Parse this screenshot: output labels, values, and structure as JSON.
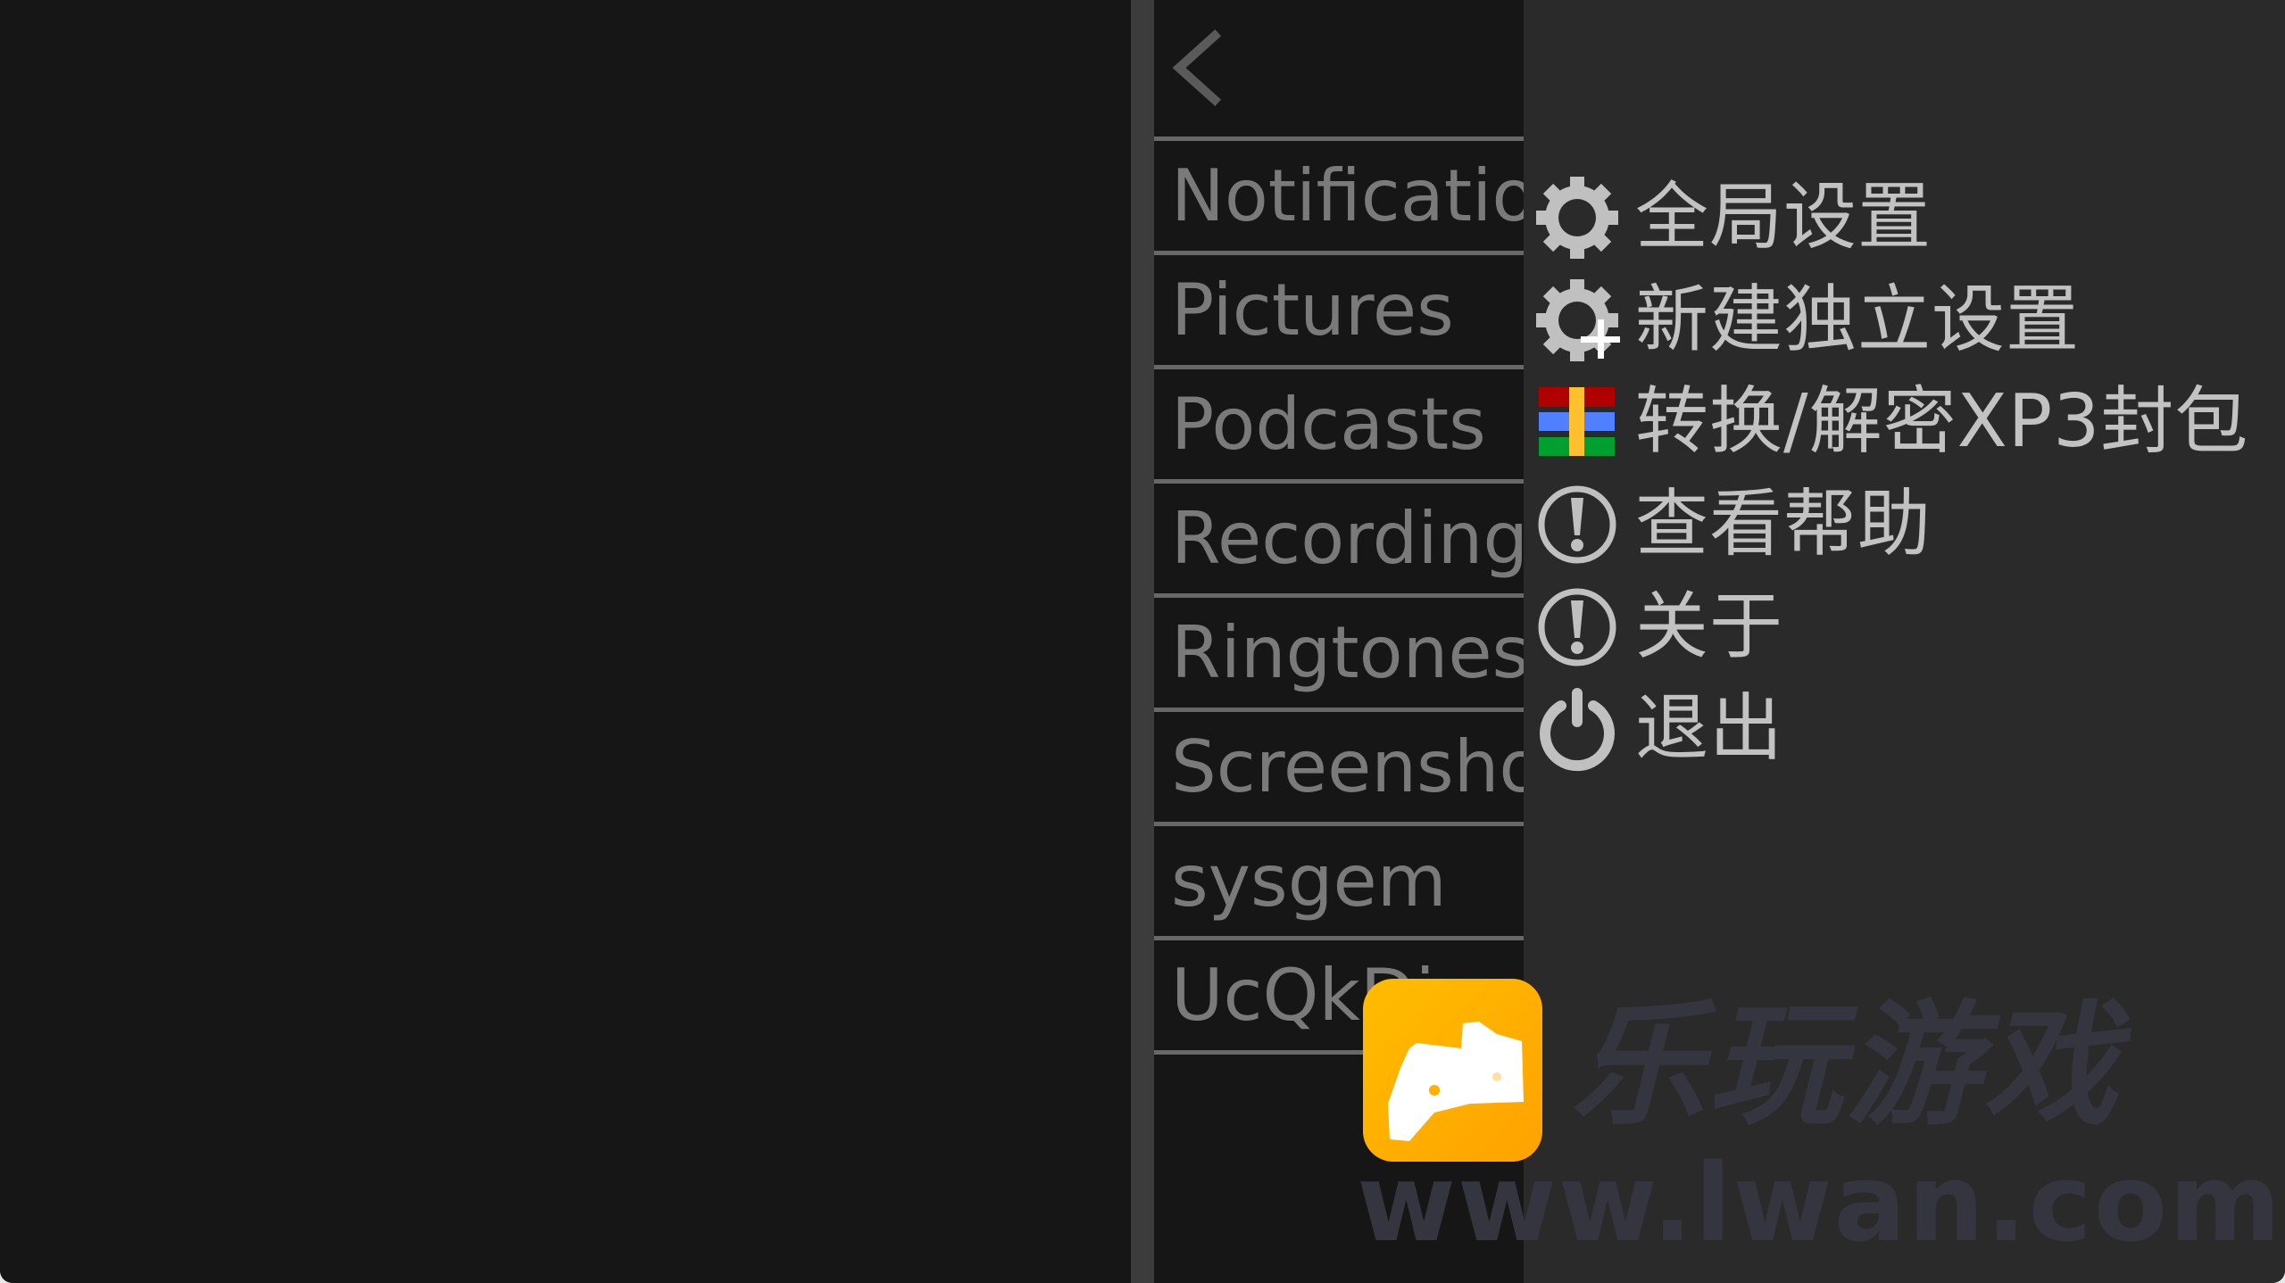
{
  "file_browser": {
    "back_icon": "chevron-left-icon",
    "items": [
      {
        "label": "Notifications"
      },
      {
        "label": "Pictures"
      },
      {
        "label": "Podcasts"
      },
      {
        "label": "Recordings"
      },
      {
        "label": "Ringtones"
      },
      {
        "label": "Screenshots"
      },
      {
        "label": "sysgem"
      },
      {
        "label": "UcQkDir"
      }
    ]
  },
  "menu": {
    "items": [
      {
        "label": "全局设置",
        "icon": "gear-icon"
      },
      {
        "label": "新建独立设置",
        "icon": "gear-plus-icon"
      },
      {
        "label": "转换/解密XP3封包",
        "icon": "xp3-archive-icon"
      },
      {
        "label": "查看帮助",
        "icon": "info-exclamation-icon"
      },
      {
        "label": "关于",
        "icon": "info-exclamation-icon"
      },
      {
        "label": "退出",
        "icon": "power-icon"
      }
    ]
  },
  "watermark": {
    "title": "乐玩游戏",
    "url": "www.lwan.com",
    "logo_icon": "gamepad-logo-icon"
  },
  "colors": {
    "background": "#161616",
    "divider": "#3c3c3c",
    "menu_background": "#2a2a2a",
    "menu_text": "#c2c2c2",
    "file_text": "#7a7a7a",
    "xp3_red": "#b00000",
    "xp3_blue": "#5080ff",
    "xp3_green": "#00a030",
    "xp3_yellow": "#ffc030",
    "logo_orange": "#ffae00"
  }
}
